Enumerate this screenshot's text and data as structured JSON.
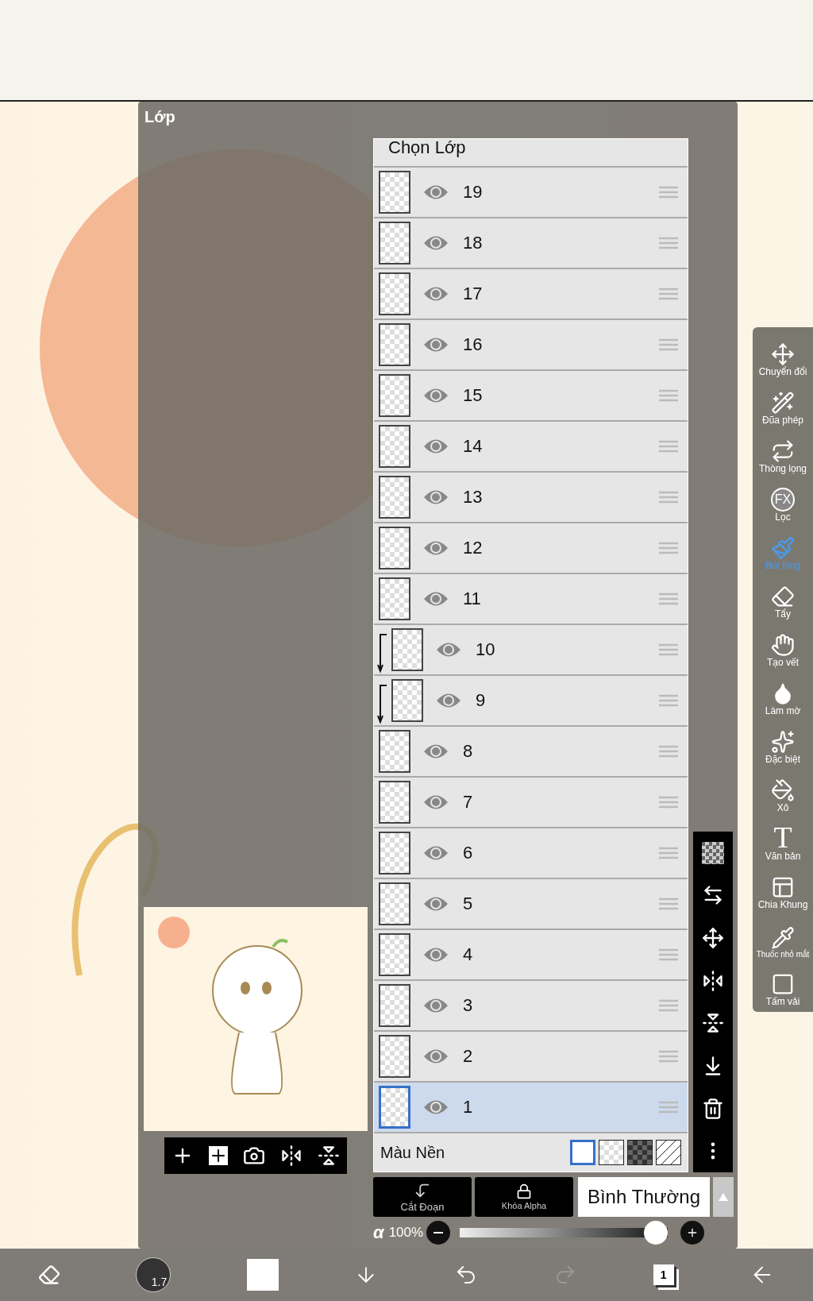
{
  "panel": {
    "title": "Lớp"
  },
  "select_layer_row": {
    "label": "Chọn Lớp"
  },
  "layers": [
    {
      "name": "19",
      "visible": true,
      "selected": false,
      "clipped": false
    },
    {
      "name": "18",
      "visible": true,
      "selected": false,
      "clipped": false
    },
    {
      "name": "17",
      "visible": true,
      "selected": false,
      "clipped": false
    },
    {
      "name": "16",
      "visible": true,
      "selected": false,
      "clipped": false
    },
    {
      "name": "15",
      "visible": true,
      "selected": false,
      "clipped": false
    },
    {
      "name": "14",
      "visible": true,
      "selected": false,
      "clipped": false
    },
    {
      "name": "13",
      "visible": true,
      "selected": false,
      "clipped": false
    },
    {
      "name": "12",
      "visible": true,
      "selected": false,
      "clipped": false
    },
    {
      "name": "11",
      "visible": true,
      "selected": false,
      "clipped": false
    },
    {
      "name": "10",
      "visible": true,
      "selected": false,
      "clipped": true
    },
    {
      "name": "9",
      "visible": true,
      "selected": false,
      "clipped": true
    },
    {
      "name": "8",
      "visible": true,
      "selected": false,
      "clipped": false
    },
    {
      "name": "7",
      "visible": true,
      "selected": false,
      "clipped": false
    },
    {
      "name": "6",
      "visible": true,
      "selected": false,
      "clipped": false
    },
    {
      "name": "5",
      "visible": true,
      "selected": false,
      "clipped": false
    },
    {
      "name": "4",
      "visible": true,
      "selected": false,
      "clipped": false
    },
    {
      "name": "3",
      "visible": true,
      "selected": false,
      "clipped": false
    },
    {
      "name": "2",
      "visible": true,
      "selected": false,
      "clipped": false
    },
    {
      "name": "1",
      "visible": true,
      "selected": true,
      "clipped": false
    }
  ],
  "background_color": {
    "label": "Màu Nền",
    "options": [
      {
        "kind": "white",
        "selected": true
      },
      {
        "kind": "checker",
        "selected": false
      },
      {
        "kind": "dark",
        "selected": false
      },
      {
        "kind": "none",
        "selected": false
      }
    ]
  },
  "layer_buttons": [
    {
      "kind": "clip",
      "label": "Cắt Đoạn"
    },
    {
      "kind": "alpha",
      "label": "Khóa Alpha"
    }
  ],
  "blend_mode": {
    "value": "Bình Thường"
  },
  "opacity": {
    "symbol": "α",
    "reading": "100%",
    "level": 1
  },
  "tools": [
    {
      "kind": "move",
      "label": "Chuyển đổi",
      "selected": false
    },
    {
      "kind": "wand",
      "label": "Đũa phép",
      "selected": false
    },
    {
      "kind": "lasso",
      "label": "Thòng lọng",
      "selected": false
    },
    {
      "kind": "fx",
      "label": "Lọc",
      "icon_text": "FX",
      "selected": false
    },
    {
      "kind": "brush",
      "label": "Bút lông",
      "selected": true
    },
    {
      "kind": "eraser",
      "label": "Tẩy",
      "selected": false
    },
    {
      "kind": "smudge",
      "label": "Tạo vết",
      "selected": false
    },
    {
      "kind": "blur",
      "label": "Làm mờ",
      "selected": false
    },
    {
      "kind": "special",
      "label": "Đặc biệt",
      "selected": false
    },
    {
      "kind": "bucket",
      "label": "Xô",
      "selected": false
    },
    {
      "kind": "text",
      "label": "Văn bản",
      "icon_text": "T",
      "selected": false
    },
    {
      "kind": "frame",
      "label": "Chia Khung",
      "selected": false
    },
    {
      "kind": "dropper",
      "label": "Thuốc nhỏ mắt",
      "selected": false
    },
    {
      "kind": "canvas",
      "label": "Tấm vải",
      "selected": false
    }
  ],
  "bottom_bar": {
    "brush_size": "1.7",
    "page": "1"
  }
}
